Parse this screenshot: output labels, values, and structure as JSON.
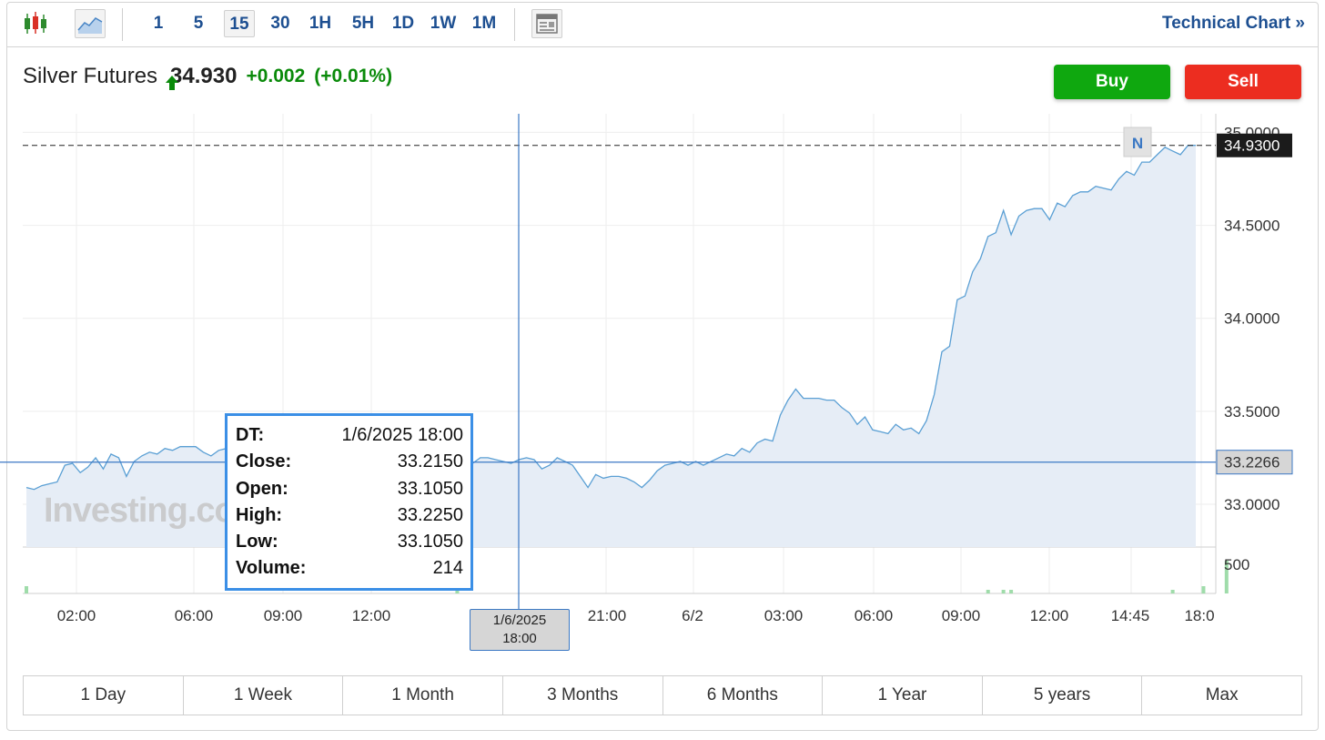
{
  "toolbar": {
    "icons": [
      "candlestick-chart-icon",
      "area-chart-icon",
      "news-layout-icon"
    ],
    "timeframes": [
      "1",
      "5",
      "15",
      "30",
      "1H",
      "5H",
      "1D",
      "1W",
      "1M"
    ],
    "active_timeframe": "15",
    "technical_link": "Technical Chart »"
  },
  "quote": {
    "name": "Silver Futures",
    "price": "34.930",
    "change": "+0.002",
    "change_pct": "(+0.01%)",
    "direction": "up",
    "up_color": "#0a8a0a"
  },
  "actions": {
    "buy": "Buy",
    "sell": "Sell",
    "buy_color": "#0fa80f",
    "sell_color": "#ec2d20"
  },
  "tooltip": {
    "rows": [
      {
        "k": "DT:",
        "v": "1/6/2025 18:00"
      },
      {
        "k": "Close:",
        "v": "33.2150"
      },
      {
        "k": "Open:",
        "v": "33.1050"
      },
      {
        "k": "High:",
        "v": "33.2250"
      },
      {
        "k": "Low:",
        "v": "33.1050"
      },
      {
        "k": "Volume:",
        "v": "214"
      }
    ]
  },
  "crosshair": {
    "date_line1": "1/6/2025",
    "date_line2": "18:00",
    "price": "33.2266"
  },
  "last_price_label": "34.9300",
  "news_marker": "N",
  "watermark": "Investing.co",
  "ranges": [
    "1 Day",
    "1 Week",
    "1 Month",
    "3 Months",
    "6 Months",
    "1 Year",
    "5 years",
    "Max"
  ],
  "chart_data": {
    "type": "area",
    "line_color": "#5a9fd4",
    "fill_color": "#e6edf6",
    "grid": true,
    "ylim": [
      32.77,
      35.1
    ],
    "yticks": [
      "35.0000",
      "34.5000",
      "34.0000",
      "33.5000",
      "33.0000"
    ],
    "ytick_values": [
      35.0,
      34.5,
      34.0,
      33.5,
      33.0
    ],
    "volume_tick": "500",
    "xticks": [
      "02:00",
      "06:00",
      "09:00",
      "12:00",
      "21:00",
      "6/2",
      "03:00",
      "06:00",
      "09:00",
      "12:00",
      "14:45",
      "18:0"
    ],
    "price": [
      33.09,
      33.08,
      33.1,
      33.11,
      33.12,
      33.21,
      33.22,
      33.17,
      33.2,
      33.25,
      33.19,
      33.27,
      33.25,
      33.15,
      33.23,
      33.26,
      33.28,
      33.27,
      33.3,
      33.29,
      33.31,
      33.31,
      33.31,
      33.28,
      33.26,
      33.29,
      33.3,
      33.29,
      33.28,
      33.26,
      33.22,
      33.25,
      33.24,
      33.28,
      33.3,
      33.27,
      33.18,
      33.22,
      33.14,
      33.08,
      33.11,
      33.12,
      33.1,
      33.04,
      33.02,
      33.05,
      33.06,
      33.07,
      33.06,
      33.07,
      33.06,
      33.06,
      33.08,
      33.06,
      33.06,
      33.07,
      33.21,
      33.2,
      33.22,
      33.25,
      33.25,
      33.24,
      33.23,
      33.22,
      33.24,
      33.25,
      33.24,
      33.19,
      33.21,
      33.25,
      33.23,
      33.21,
      33.15,
      33.09,
      33.16,
      33.14,
      33.15,
      33.15,
      33.14,
      33.12,
      33.09,
      33.13,
      33.18,
      33.21,
      33.22,
      33.23,
      33.21,
      33.23,
      33.21,
      33.23,
      33.25,
      33.27,
      33.26,
      33.3,
      33.28,
      33.33,
      33.35,
      33.34,
      33.48,
      33.56,
      33.62,
      33.57,
      33.57,
      33.57,
      33.56,
      33.56,
      33.52,
      33.49,
      33.43,
      33.47,
      33.4,
      33.39,
      33.38,
      33.43,
      33.4,
      33.41,
      33.38,
      33.45,
      33.59,
      33.82,
      33.85,
      34.1,
      34.12,
      34.25,
      34.32,
      34.44,
      34.46,
      34.58,
      34.45,
      34.55,
      34.58,
      34.59,
      34.59,
      34.53,
      34.62,
      34.6,
      34.66,
      34.68,
      34.68,
      34.71,
      34.7,
      34.69,
      34.75,
      34.79,
      34.77,
      34.84,
      34.84,
      34.88,
      34.92,
      34.9,
      34.88,
      34.93,
      34.93
    ],
    "volume": [
      2,
      0,
      0,
      0,
      0,
      0,
      0,
      0,
      0,
      0,
      0,
      0,
      0,
      0,
      0,
      0,
      0,
      0,
      0,
      0,
      0,
      0,
      0,
      0,
      0,
      0,
      0,
      0,
      0,
      0,
      0,
      0,
      0,
      0,
      0,
      0,
      0,
      0,
      0,
      0,
      0,
      0,
      0,
      0,
      0,
      0,
      0,
      0,
      0,
      0,
      0,
      0,
      0,
      0,
      0,
      0,
      4,
      0,
      0,
      0,
      0,
      0,
      0,
      0,
      0,
      0,
      0,
      0,
      0,
      0,
      0,
      0,
      0,
      0,
      0,
      0,
      0,
      0,
      0,
      0,
      0,
      0,
      0,
      0,
      0,
      0,
      0,
      0,
      0,
      0,
      0,
      0,
      0,
      0,
      0,
      0,
      0,
      0,
      0,
      0,
      0,
      0,
      0,
      0,
      0,
      0,
      0,
      0,
      0,
      0,
      0,
      0,
      0,
      0,
      0,
      0,
      0,
      0,
      0,
      0,
      0,
      0,
      0,
      0,
      0,
      1,
      0,
      1,
      1,
      0,
      0,
      0,
      0,
      0,
      0,
      0,
      0,
      0,
      0,
      0,
      0,
      0,
      0,
      0,
      0,
      0,
      0,
      0,
      0,
      1,
      0,
      0,
      0,
      2,
      0,
      0,
      9
    ]
  }
}
